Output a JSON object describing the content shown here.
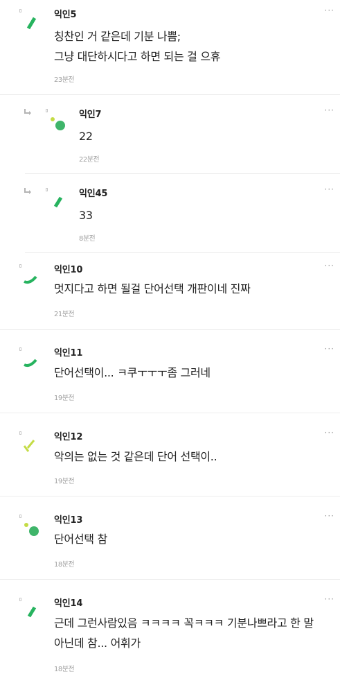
{
  "comments": [
    {
      "name": "익인5",
      "text_lines": [
        "칭찬인 거 같은데 기분 나쁨;",
        "그냥 대단하시다고 하면 되는 걸 으휴"
      ],
      "time": "23분전",
      "avatar_icon": "green-dash-icon",
      "is_reply": false
    },
    {
      "name": "익인7",
      "text_lines": [
        "22"
      ],
      "time": "22분전",
      "avatar_icon": "green-dots-icon",
      "is_reply": true
    },
    {
      "name": "익인45",
      "text_lines": [
        "33"
      ],
      "time": "8분전",
      "avatar_icon": "green-dash-icon",
      "is_reply": true
    },
    {
      "name": "익인10",
      "text_lines": [
        "멋지다고 하면 될걸 단어선택 개판이네 진짜"
      ],
      "time": "21분전",
      "avatar_icon": "green-curve-icon",
      "is_reply": false
    },
    {
      "name": "익인11",
      "text_lines": [
        "단어선택이... ㅋ쿠ㅜㅜㅜ좀 그러네"
      ],
      "time": "19분전",
      "avatar_icon": "green-curve-icon",
      "is_reply": false
    },
    {
      "name": "익인12",
      "text_lines": [
        "악의는 없는 것 같은데 단어 선택이.."
      ],
      "time": "19분전",
      "avatar_icon": "lime-strokes-icon",
      "is_reply": false
    },
    {
      "name": "익인13",
      "text_lines": [
        "단어선택 참"
      ],
      "time": "18분전",
      "avatar_icon": "green-dots-icon",
      "is_reply": false
    },
    {
      "name": "익인14",
      "text_lines": [
        "근데 그런사람있음 ㅋㅋㅋㅋ 꼭ㅋㅋㅋ 기분나쁘라고 한 말",
        "아닌데 참... 어휘가"
      ],
      "time": "18분전",
      "avatar_icon": "green-dash-icon",
      "is_reply": false
    }
  ],
  "more_label": "···",
  "colors": {
    "accent_green": "#27b35f",
    "lime": "#c4dc45",
    "meta_gray": "#a0a0a0",
    "divider": "#ececec"
  }
}
